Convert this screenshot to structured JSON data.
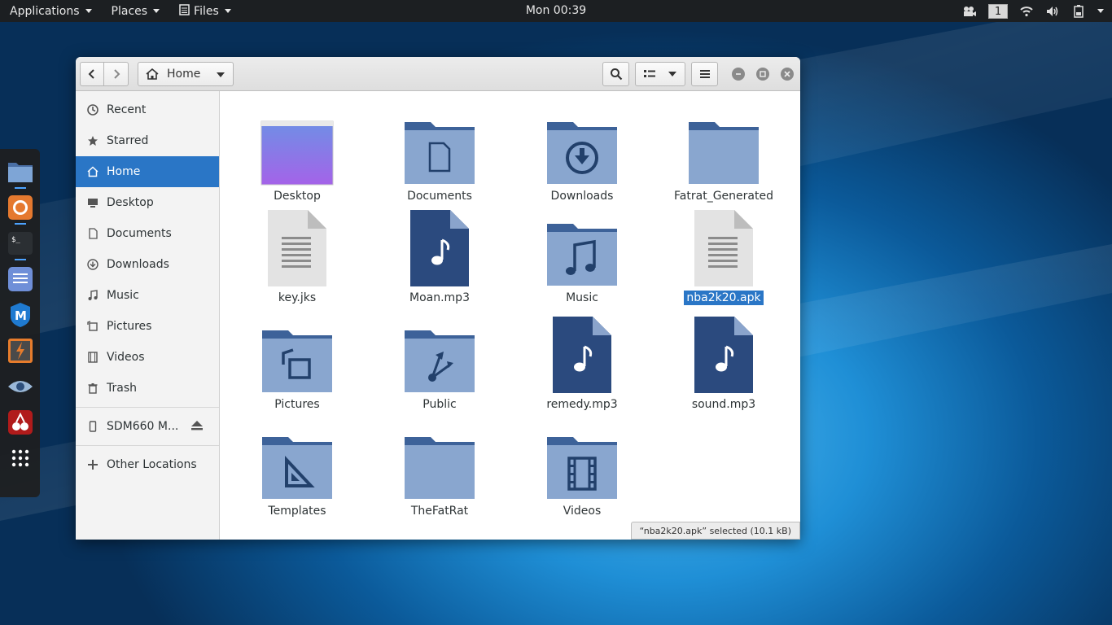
{
  "topbar": {
    "applications": "Applications",
    "places": "Places",
    "files": "Files",
    "clock": "Mon 00:39",
    "workspace": "1"
  },
  "dock": {
    "items": [
      "files-app-icon",
      "firefox-icon",
      "terminal-icon",
      "text-editor-icon",
      "metasploit-icon",
      "burpsuite-icon",
      "eye-icon",
      "cherry-icon",
      "show-apps-icon"
    ]
  },
  "window": {
    "path_label": "Home",
    "sidebar": [
      {
        "label": "Recent",
        "icon": "clock-icon"
      },
      {
        "label": "Starred",
        "icon": "star-icon"
      },
      {
        "label": "Home",
        "icon": "home-icon",
        "active": true
      },
      {
        "label": "Desktop",
        "icon": "monitor-icon"
      },
      {
        "label": "Documents",
        "icon": "document-icon"
      },
      {
        "label": "Downloads",
        "icon": "download-icon"
      },
      {
        "label": "Music",
        "icon": "music-icon"
      },
      {
        "label": "Pictures",
        "icon": "picture-icon"
      },
      {
        "label": "Videos",
        "icon": "film-icon"
      },
      {
        "label": "Trash",
        "icon": "trash-icon"
      }
    ],
    "device": {
      "label": "SDM660 M...",
      "icon": "phone-icon"
    },
    "other_locations": "Other Locations",
    "files": [
      {
        "name": "Desktop",
        "type": "desktop-folder"
      },
      {
        "name": "Documents",
        "type": "documents-folder"
      },
      {
        "name": "Downloads",
        "type": "downloads-folder"
      },
      {
        "name": "Fatrat_Generated",
        "type": "folder"
      },
      {
        "name": "key.jks",
        "type": "text-file"
      },
      {
        "name": "Moan.mp3",
        "type": "audio-file"
      },
      {
        "name": "Music",
        "type": "music-folder"
      },
      {
        "name": "nba2k20.apk",
        "type": "text-file",
        "selected": true
      },
      {
        "name": "Pictures",
        "type": "pictures-folder"
      },
      {
        "name": "Public",
        "type": "public-folder"
      },
      {
        "name": "remedy.mp3",
        "type": "audio-file"
      },
      {
        "name": "sound.mp3",
        "type": "audio-file"
      },
      {
        "name": "Templates",
        "type": "templates-folder"
      },
      {
        "name": "TheFatRat",
        "type": "folder"
      },
      {
        "name": "Videos",
        "type": "videos-folder"
      }
    ],
    "status": "“nba2k20.apk” selected  (10.1 kB)"
  }
}
